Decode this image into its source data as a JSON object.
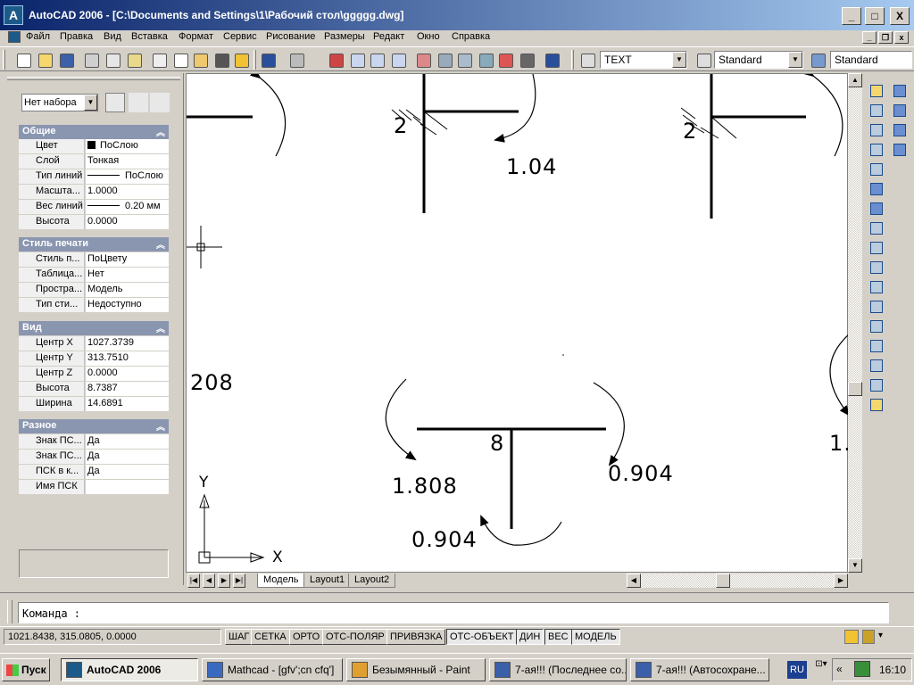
{
  "window": {
    "title": "AutoCAD 2006 - [C:\\Documents and Settings\\1\\Рабочий стол\\ggggg.dwg]",
    "app_icon": "autocad-icon",
    "controls": [
      "_",
      "□",
      "X"
    ]
  },
  "menu": {
    "items": [
      "Файл",
      "Правка",
      "Вид",
      "Вставка",
      "Формат",
      "Сервис",
      "Рисование",
      "Размеры",
      "Редакт",
      "Окно",
      "Справка"
    ]
  },
  "toolbar": {
    "text_style": "TEXT",
    "dim_style": "Standard",
    "table_style": "Standard",
    "icons": [
      "new-icon",
      "open-icon",
      "save-icon",
      "print-icon",
      "preview-icon",
      "publish-icon",
      "cut-icon",
      "copy-icon",
      "paste-icon",
      "matchprop-icon",
      "blockedit-icon",
      "undo-icon",
      "redo-icon",
      "pan-icon",
      "zoom-realtime-icon",
      "zoom-window-icon",
      "zoom-previous-icon",
      "properties-icon",
      "designcenter-icon",
      "toolpalettes-icon",
      "sheetset-icon",
      "markup-icon",
      "calculator-icon",
      "help-icon"
    ]
  },
  "props": {
    "selection": "Нет набора",
    "sections": [
      {
        "title": "Общие",
        "rows": [
          {
            "k": "Цвет",
            "v": "ПоСлою"
          },
          {
            "k": "Слой",
            "v": "Тонкая"
          },
          {
            "k": "Тип линий",
            "v": "ПоСлою"
          },
          {
            "k": "Масшта...",
            "v": "1.0000"
          },
          {
            "k": "Вес линий",
            "v": "0.20 мм"
          },
          {
            "k": "Высота",
            "v": "0.0000"
          }
        ]
      },
      {
        "title": "Стиль печати",
        "rows": [
          {
            "k": "Стиль п...",
            "v": "ПоЦвету"
          },
          {
            "k": "Таблица...",
            "v": "Нет"
          },
          {
            "k": "Простра...",
            "v": "Модель"
          },
          {
            "k": "Тип сти...",
            "v": "Недоступно"
          }
        ]
      },
      {
        "title": "Вид",
        "rows": [
          {
            "k": "Центр X",
            "v": "1027.3739"
          },
          {
            "k": "Центр Y",
            "v": "313.7510"
          },
          {
            "k": "Центр Z",
            "v": "0.0000"
          },
          {
            "k": "Высота",
            "v": "8.7387"
          },
          {
            "k": "Ширина",
            "v": "14.6891"
          }
        ]
      },
      {
        "title": "Разное",
        "rows": [
          {
            "k": "Знак ПС...",
            "v": "Да"
          },
          {
            "k": "Знак ПС...",
            "v": "Да"
          },
          {
            "k": "ПСК в к...",
            "v": "Да"
          },
          {
            "k": "Имя ПСК",
            "v": ""
          }
        ]
      }
    ]
  },
  "drawing": {
    "labels": {
      "a": "2",
      "b": "1.04",
      "c": "2",
      "d": "208",
      "e": "8",
      "f": "1.808",
      "g": "0.904",
      "h": "0.904",
      "i": "1."
    },
    "ucs_x": "X",
    "ucs_y": "Y"
  },
  "tabs": [
    "Модель",
    "Layout1",
    "Layout2"
  ],
  "command": {
    "prompt": "Команда :"
  },
  "status": {
    "coords": "1021.8438, 315.0805, 0.0000",
    "buttons": [
      "ШАГ",
      "СЕТКА",
      "ОРТО",
      "ОТС-ПОЛЯР",
      "ПРИВЯЗКА",
      "ОТС-ОБЪЕКТ",
      "ДИН",
      "ВЕС",
      "МОДЕЛЬ"
    ],
    "on": [
      "ОТС-ОБЪЕКТ",
      "ДИН",
      "ВЕС",
      "МОДЕЛЬ"
    ]
  },
  "taskbar": {
    "start": "Пуск",
    "tasks": [
      {
        "label": "AutoCAD 2006",
        "icon": "autocad-icon",
        "active": true
      },
      {
        "label": "Mathcad - [gfv';cn cfq']",
        "icon": "mathcad-icon",
        "active": false
      },
      {
        "label": "Безымянный - Paint",
        "icon": "paint-icon",
        "active": false
      },
      {
        "label": "7-ая!!! (Последнее со...",
        "icon": "word-icon",
        "active": false
      },
      {
        "label": "7-ая!!! (Автосохране...",
        "icon": "word-icon",
        "active": false
      }
    ],
    "lang": "RU",
    "time": "16:10"
  },
  "colors": {
    "title_start": "#0a246a",
    "title_end": "#a6caf0",
    "section_header": "#8a96b0",
    "background": "#d4d0c8"
  }
}
